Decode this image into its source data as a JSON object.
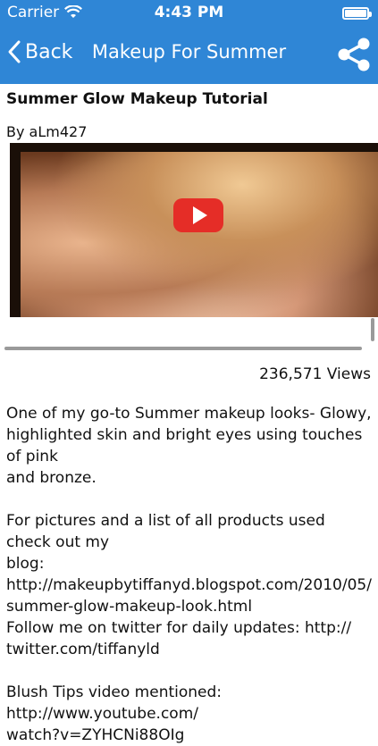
{
  "status_bar": {
    "carrier": "Carrier",
    "time": "4:43 PM"
  },
  "nav": {
    "back_label": "Back",
    "title": "Makeup For Summer"
  },
  "video": {
    "title": "Summer Glow Makeup Tutorial",
    "author": "By aLm427",
    "views": "236,571 Views"
  },
  "description": {
    "line1": "One of my go-to Summer makeup looks- Glowy,",
    "line2": "highlighted skin and bright eyes using touches of pink",
    "line3": "and bronze.",
    "line4": "For pictures and a list of all products used check out my",
    "line5": "blog:",
    "line6": " http://makeupbytiffanyd.blogspot.com/2010/05/",
    "line7": "summer-glow-makeup-look.html",
    "line8": "Follow me on twitter for daily updates: http://",
    "line9": "twitter.com/tiffanyld",
    "line10": "Blush Tips video mentioned: http://www.youtube.com/",
    "line11": "watch?v=ZYHCNi88OIg"
  },
  "colors": {
    "nav_bg": "#2f86d6",
    "play_button": "#e52d27"
  }
}
